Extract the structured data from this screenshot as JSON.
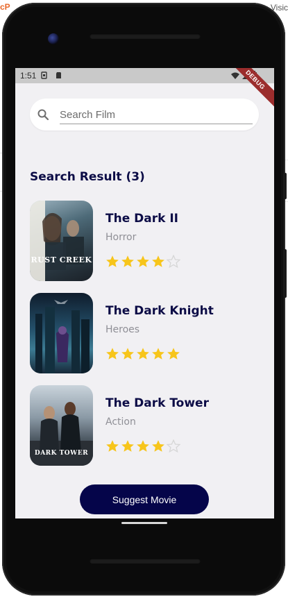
{
  "desktop": {
    "logo_text": "cP",
    "right_text": "Visic"
  },
  "status_bar": {
    "time": "1:51",
    "debug_label": "DEBUG"
  },
  "search": {
    "placeholder": "Search Film",
    "value": ""
  },
  "results": {
    "title": "Search Result (3)",
    "movies": [
      {
        "title": "The Dark II",
        "genre": "Horror",
        "rating": 4,
        "max_rating": 5,
        "poster_text": "RUST CREEK"
      },
      {
        "title": "The Dark Knight",
        "genre": "Heroes",
        "rating": 5,
        "max_rating": 5,
        "poster_text": ""
      },
      {
        "title": "The Dark Tower",
        "genre": "Action",
        "rating": 4,
        "max_rating": 5,
        "poster_text": "DARK TOWER"
      }
    ]
  },
  "actions": {
    "suggest_label": "Suggest Movie"
  },
  "colors": {
    "accent": "#05054a",
    "title_text": "#0c0c46",
    "star_filled": "#f7c51b",
    "star_empty": "#d6d6d6",
    "background": "#f1f0f3"
  }
}
